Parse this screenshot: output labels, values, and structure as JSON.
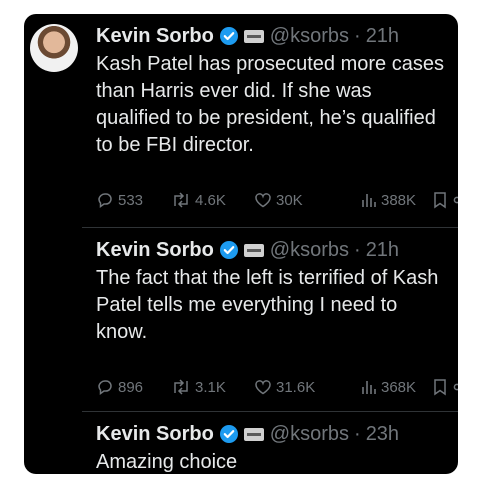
{
  "tweets": [
    {
      "author_name": "Kevin Sorbo",
      "handle": "@ksorbs",
      "separator": "·",
      "time": "21h",
      "text": "Kash Patel has prosecuted more cases than Harris ever did. If she was qualified to be president, he’s qualified to be FBI director.",
      "replies": "533",
      "reposts": "4.6K",
      "likes": "30K",
      "views": "388K"
    },
    {
      "author_name": "Kevin Sorbo",
      "handle": "@ksorbs",
      "separator": "·",
      "time": "21h",
      "text": "The fact that the left is terrified of Kash Patel tells me everything I need to know.",
      "replies": "896",
      "reposts": "3.1K",
      "likes": "31.6K",
      "views": "368K"
    },
    {
      "author_name": "Kevin Sorbo",
      "handle": "@ksorbs",
      "separator": "·",
      "time": "23h",
      "text": "Amazing choice"
    }
  ],
  "colors": {
    "background": "#000000",
    "primary_text": "#e7e9ea",
    "secondary_text": "#71767b",
    "verified_blue": "#1d9bf0"
  },
  "icons": [
    "reply-icon",
    "repost-icon",
    "like-icon",
    "views-icon",
    "bookmark-icon",
    "share-icon",
    "verified-badge-icon"
  ]
}
